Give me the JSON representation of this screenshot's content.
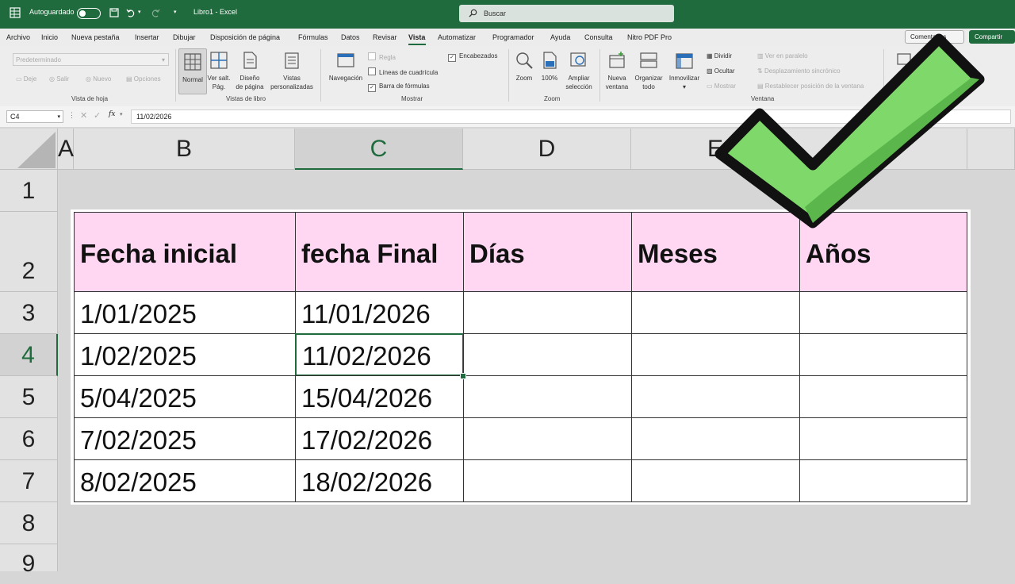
{
  "titlebar": {
    "autosave_label": "Autoguardado",
    "filename": "Libro1 - Excel",
    "search_placeholder": "Buscar"
  },
  "menu": {
    "items": [
      "Archivo",
      "Inicio",
      "Nueva pestaña",
      "Insertar",
      "Dibujar",
      "Disposición de página",
      "Fórmulas",
      "Datos",
      "Revisar",
      "Vista",
      "Automatizar",
      "Programador",
      "Ayuda",
      "Consulta",
      "Nitro PDF Pro"
    ],
    "active": "Vista",
    "comments_label": "Comentarios",
    "share_label": "Compartir"
  },
  "ribbon": {
    "sheet_view": {
      "dropdown": "Predeterminado",
      "keep": "Deje",
      "exit": "Salir",
      "new": "Nuevo",
      "options": "Opciones",
      "group_label": "Vista de hoja"
    },
    "workbook_views": {
      "normal": "Normal",
      "page_break_1": "Ver salt.",
      "page_break_2": "Pág.",
      "page_layout_1": "Diseño",
      "page_layout_2": "de página",
      "custom_1": "Vistas",
      "custom_2": "personalizadas",
      "group_label": "Vistas de libro"
    },
    "show": {
      "navigation": "Navegación",
      "ruler": "Regla",
      "gridlines": "Líneas de cuadrícula",
      "formula_bar": "Barra de fórmulas",
      "headings": "Encabezados",
      "group_label": "Mostrar"
    },
    "zoom": {
      "zoom": "Zoom",
      "hundred": "100%",
      "zoom_sel_1": "Ampliar",
      "zoom_sel_2": "selección",
      "group_label": "Zoom"
    },
    "window": {
      "new_1": "Nueva",
      "new_2": "ventana",
      "arrange_1": "Organizar",
      "arrange_2": "todo",
      "freeze": "Inmovilizar",
      "split": "Dividir",
      "hide": "Ocultar",
      "unhide": "Mostrar",
      "side_by_side": "Ver en paralelo",
      "sync_scroll": "Desplazamiento sincrónico",
      "reset_pos": "Restablecer posición de la ventana",
      "group_label": "Ventana"
    }
  },
  "formula_bar": {
    "name_box": "C4",
    "fx": "fx",
    "value": "11/02/2026"
  },
  "columns": [
    "A",
    "B",
    "C",
    "D",
    "E"
  ],
  "rows": [
    "1",
    "2",
    "3",
    "4",
    "5",
    "6",
    "7",
    "8",
    "9"
  ],
  "table": {
    "headers": [
      "Fecha inicial",
      "fecha Final",
      "Días",
      "Meses",
      "Años"
    ],
    "rows": [
      [
        "1/01/2025",
        "11/01/2026",
        "",
        "",
        ""
      ],
      [
        "1/02/2025",
        "11/02/2026",
        "",
        "",
        ""
      ],
      [
        "5/04/2025",
        "15/04/2026",
        "",
        "",
        ""
      ],
      [
        "7/02/2025",
        "17/02/2026",
        "",
        "",
        ""
      ],
      [
        "8/02/2025",
        "18/02/2026",
        "",
        "",
        ""
      ]
    ]
  },
  "colors": {
    "excel_green": "#1f6b3d",
    "header_fill": "#ffd7f2",
    "check_green": "#7ed86a"
  }
}
